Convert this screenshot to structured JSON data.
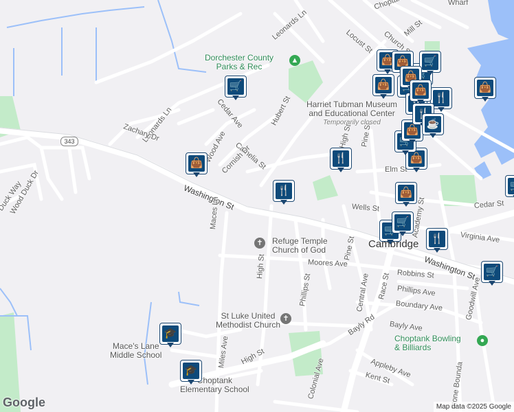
{
  "map": {
    "colors": {
      "background": "#f1f0f3",
      "water": "#9cc0f9",
      "park": "#c3ebc9",
      "road": "#ffffff",
      "pin": "#0e4a7a"
    },
    "streets": {
      "leonards_ln_top": "Leonards Ln",
      "leonards_ln": "Leonards Ln",
      "zachary_dr": "Zachary Dr",
      "cedar_ave_left": "Cedar Ave",
      "wood_ave": "Wood Ave",
      "camelia_st": "Camelia St",
      "cornish_dr": "Cornish Dr",
      "hubert_st": "Hubert St",
      "washington_st_west": "Washington St",
      "washington_st_east": "Washington St",
      "duck_way": "Duck Way",
      "wood_duck_dr": "Wood Duck Dr",
      "maces_ln": "Maces Ln",
      "high_st_north": "High St",
      "high_st": "High St",
      "high_st_south": "High St",
      "elm_st": "Elm St",
      "pine_st_north": "Pine St",
      "pine_st": "Pine St",
      "wells_st": "Wells St",
      "cedar_st": "Cedar St",
      "academy_st": "Academy St",
      "virginia_ave": "Virginia Ave",
      "moores_ave": "Moores Ave",
      "phillips_st": "Phillips St",
      "robbins_st": "Robbins St",
      "phillips_ave": "Phillips Ave",
      "boundary_ave": "Boundary Ave",
      "central_ave": "Central Ave",
      "race_st": "Race St",
      "goodwill_ave": "Goodwill Ave",
      "bayly_ave": "Bayly Ave",
      "bayly_rd": "Bayly Rd",
      "miles_ave": "Miles Ave",
      "colonial_ave": "Colonial Ave",
      "appleby_ave": "Appleby Ave",
      "kent_st": "Kent St",
      "stone_boundary": "Stone Bounda",
      "locust_st": "Locust St",
      "church_st": "Church St",
      "mill_st": "Mill St",
      "choptank_top": "Choptank",
      "wharf": "Wharf",
      "route_343": "343"
    },
    "places": {
      "dorchester_parks": {
        "line1": "Dorchester County",
        "line2": "Parks & Rec"
      },
      "harriet_tubman": {
        "line1": "Harriet Tubman Museum",
        "line2": "and Educational Center",
        "status": "Temporarily closed"
      },
      "refuge_temple": {
        "line1": "Refuge Temple",
        "line2": "Church of God"
      },
      "st_luke": {
        "line1": "St Luke United",
        "line2": "Methodist Church"
      },
      "maces_lane_school": {
        "line1": "Mace's Lane",
        "line2": "Middle School"
      },
      "choptank_elementary": {
        "line1": "Choptank",
        "line2": "Elementary School"
      },
      "choptank_bowling": {
        "line1": "Choptank Bowling",
        "line2": "& Billiards"
      },
      "cambridge": "Cambridge"
    },
    "pins": [
      {
        "icon": "shopping-cart-icon",
        "glyph": "🛒"
      },
      {
        "icon": "shopping-bag-icon",
        "glyph": "👜"
      },
      {
        "icon": "restaurant-icon",
        "glyph": "🍴"
      },
      {
        "icon": "restaurant-icon",
        "glyph": "🍴"
      },
      {
        "icon": "shopping-bag-icon",
        "glyph": "👜"
      },
      {
        "icon": "shopping-cart-icon",
        "glyph": "🛒"
      },
      {
        "icon": "shopping-cart-icon",
        "glyph": "🛒"
      },
      {
        "icon": "restaurant-icon",
        "glyph": "🍴"
      },
      {
        "icon": "shopping-cart-icon",
        "glyph": "🛒"
      },
      {
        "icon": "school-icon",
        "glyph": "🎓"
      },
      {
        "icon": "school-icon",
        "glyph": "🎓"
      },
      {
        "icon": "shopping-bag-icon",
        "glyph": "👜"
      },
      {
        "icon": "shopping-bag-icon",
        "glyph": "👜"
      },
      {
        "icon": "shopping-bag-icon",
        "glyph": "👜"
      },
      {
        "icon": "shopping-bag-icon",
        "glyph": "👜"
      },
      {
        "icon": "shopping-cart-icon",
        "glyph": "🛒"
      },
      {
        "icon": "shopping-cart-icon",
        "glyph": "🛒"
      },
      {
        "icon": "shopping-bag-icon",
        "glyph": "👜"
      },
      {
        "icon": "restaurant-icon",
        "glyph": "🍴"
      },
      {
        "icon": "shopping-cart-icon",
        "glyph": "🛒"
      },
      {
        "icon": "restaurant-icon",
        "glyph": "🍴"
      },
      {
        "icon": "restaurant-icon",
        "glyph": "🍴"
      },
      {
        "icon": "cafe-icon",
        "glyph": "☕"
      },
      {
        "icon": "shopping-bag-icon",
        "glyph": "👜"
      },
      {
        "icon": "shopping-cart-icon",
        "glyph": "🛒"
      },
      {
        "icon": "shopping-bag-icon",
        "glyph": "👜"
      },
      {
        "icon": "shopping-bag-icon",
        "glyph": "👜"
      },
      {
        "icon": "shopping-cart-icon",
        "glyph": "🛒"
      }
    ],
    "branding": "Google",
    "credit": "Map data ©2025 Google"
  }
}
